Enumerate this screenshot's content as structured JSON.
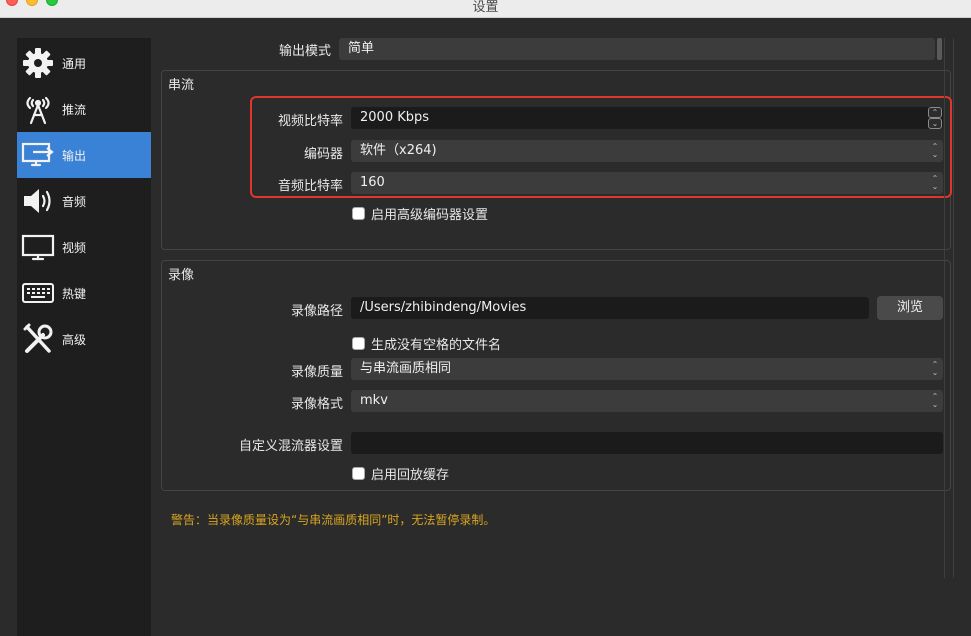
{
  "window": {
    "title": "设置"
  },
  "sidebar": {
    "items": [
      {
        "label": "通用",
        "icon": "gear-icon",
        "active": false
      },
      {
        "label": "推流",
        "icon": "broadcast-antenna-icon",
        "active": false
      },
      {
        "label": "输出",
        "icon": "output-monitor-icon",
        "active": true
      },
      {
        "label": "音频",
        "icon": "speaker-icon",
        "active": false
      },
      {
        "label": "视频",
        "icon": "monitor-icon",
        "active": false
      },
      {
        "label": "热键",
        "icon": "keyboard-icon",
        "active": false
      },
      {
        "label": "高级",
        "icon": "tools-icon",
        "active": false
      }
    ]
  },
  "output": {
    "mode_label": "输出模式",
    "mode_value": "简单"
  },
  "streaming": {
    "title": "串流",
    "video_bitrate_label": "视频比特率",
    "video_bitrate_value": "2000 Kbps",
    "encoder_label": "编码器",
    "encoder_value": "软件（x264)",
    "audio_bitrate_label": "音频比特率",
    "audio_bitrate_value": "160",
    "advanced_encoder_label": "启用高级编码器设置"
  },
  "recording": {
    "title": "录像",
    "path_label": "录像路径",
    "path_value": "/Users/zhibindeng/Movies",
    "browse_label": "浏览",
    "no_space_label": "生成没有空格的文件名",
    "quality_label": "录像质量",
    "quality_value": "与串流画质相同",
    "format_label": "录像格式",
    "format_value": "mkv",
    "muxer_label": "自定义混流器设置",
    "muxer_value": "",
    "replay_buffer_label": "启用回放缓存"
  },
  "warning": "警告：当录像质量设为“与串流画质相同”时，无法暂停录制。",
  "colors": {
    "accent": "#3a82d6",
    "highlight": "#e0362b",
    "warning": "#d9a520"
  }
}
